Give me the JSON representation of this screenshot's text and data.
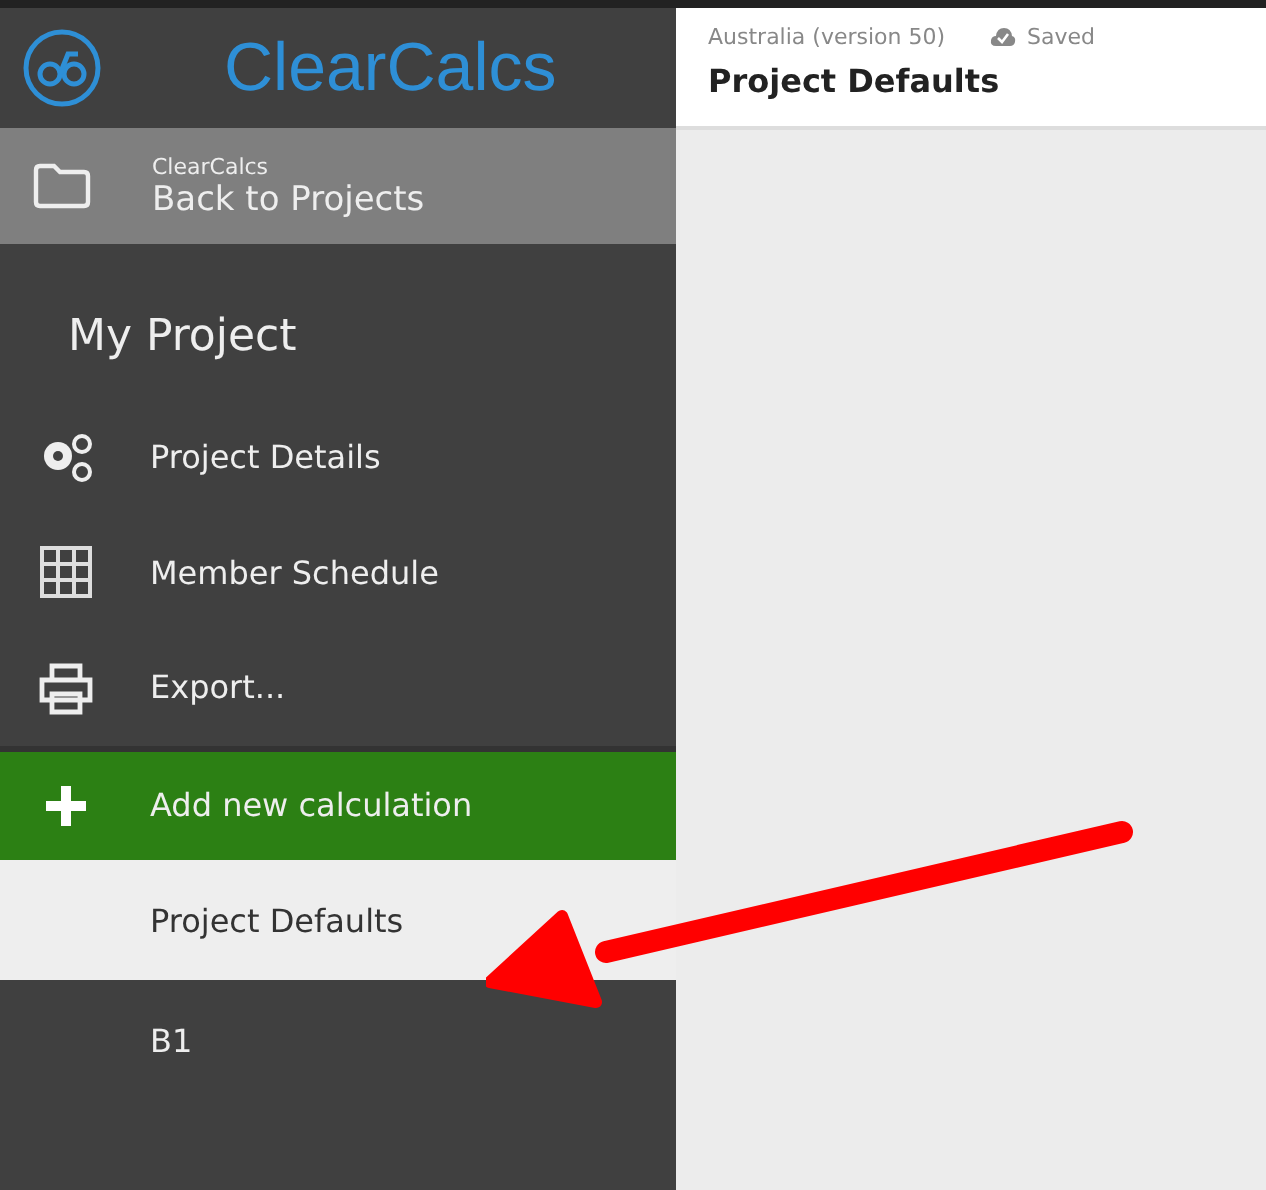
{
  "sidebar": {
    "brand": "ClearCalcs",
    "back": {
      "caption": "ClearCalcs",
      "label": "Back to Projects"
    },
    "project_title": "My Project",
    "menu": [
      {
        "kind": "gears",
        "label": "Project Details"
      },
      {
        "kind": "grid",
        "label": "Member Schedule"
      },
      {
        "kind": "printer",
        "label": "Export..."
      }
    ],
    "add_button": "Add new calculation",
    "calculations": [
      {
        "label": "Project Defaults",
        "selected": true
      },
      {
        "label": "B1",
        "selected": false
      }
    ]
  },
  "header": {
    "region": "Australia (version 50)",
    "status": "Saved",
    "title": "Project Defaults"
  }
}
